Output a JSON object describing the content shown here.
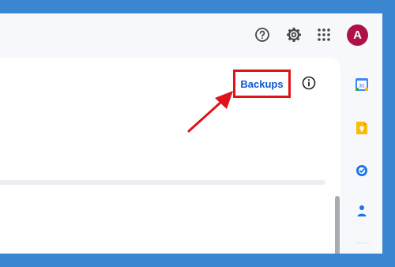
{
  "header": {
    "help_icon": "help-circle-icon",
    "settings_icon": "gear-icon",
    "apps_icon": "apps-grid-icon",
    "avatar_initial": "A",
    "avatar_color": "#B0104A"
  },
  "main": {
    "backups_label": "Backups",
    "info_icon": "info-icon",
    "highlight_color": "#E0121A"
  },
  "side_panel": {
    "apps": [
      {
        "name": "calendar",
        "icon": "calendar-icon",
        "label": "31"
      },
      {
        "name": "keep",
        "icon": "keep-icon"
      },
      {
        "name": "tasks",
        "icon": "tasks-icon"
      },
      {
        "name": "contacts",
        "icon": "contacts-icon"
      }
    ]
  }
}
